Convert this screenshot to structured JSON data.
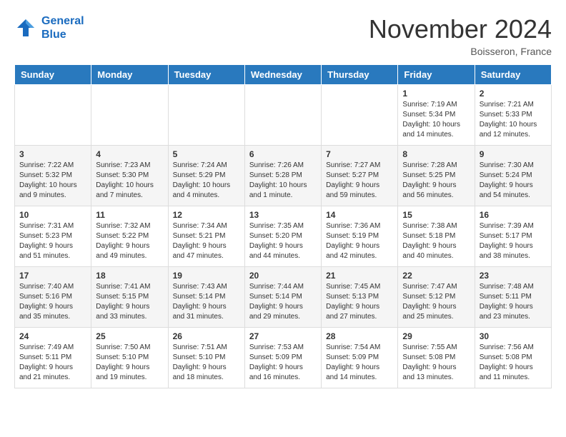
{
  "header": {
    "logo_line1": "General",
    "logo_line2": "Blue",
    "month_title": "November 2024",
    "location": "Boisseron, France"
  },
  "days_of_week": [
    "Sunday",
    "Monday",
    "Tuesday",
    "Wednesday",
    "Thursday",
    "Friday",
    "Saturday"
  ],
  "weeks": [
    {
      "cells": [
        {
          "empty": true
        },
        {
          "empty": true
        },
        {
          "empty": true
        },
        {
          "empty": true
        },
        {
          "empty": true
        },
        {
          "day": 1,
          "sunrise": "7:19 AM",
          "sunset": "5:34 PM",
          "daylight": "10 hours and 14 minutes."
        },
        {
          "day": 2,
          "sunrise": "7:21 AM",
          "sunset": "5:33 PM",
          "daylight": "10 hours and 12 minutes."
        }
      ]
    },
    {
      "cells": [
        {
          "day": 3,
          "sunrise": "7:22 AM",
          "sunset": "5:32 PM",
          "daylight": "10 hours and 9 minutes."
        },
        {
          "day": 4,
          "sunrise": "7:23 AM",
          "sunset": "5:30 PM",
          "daylight": "10 hours and 7 minutes."
        },
        {
          "day": 5,
          "sunrise": "7:24 AM",
          "sunset": "5:29 PM",
          "daylight": "10 hours and 4 minutes."
        },
        {
          "day": 6,
          "sunrise": "7:26 AM",
          "sunset": "5:28 PM",
          "daylight": "10 hours and 1 minute."
        },
        {
          "day": 7,
          "sunrise": "7:27 AM",
          "sunset": "5:27 PM",
          "daylight": "9 hours and 59 minutes."
        },
        {
          "day": 8,
          "sunrise": "7:28 AM",
          "sunset": "5:25 PM",
          "daylight": "9 hours and 56 minutes."
        },
        {
          "day": 9,
          "sunrise": "7:30 AM",
          "sunset": "5:24 PM",
          "daylight": "9 hours and 54 minutes."
        }
      ]
    },
    {
      "cells": [
        {
          "day": 10,
          "sunrise": "7:31 AM",
          "sunset": "5:23 PM",
          "daylight": "9 hours and 51 minutes."
        },
        {
          "day": 11,
          "sunrise": "7:32 AM",
          "sunset": "5:22 PM",
          "daylight": "9 hours and 49 minutes."
        },
        {
          "day": 12,
          "sunrise": "7:34 AM",
          "sunset": "5:21 PM",
          "daylight": "9 hours and 47 minutes."
        },
        {
          "day": 13,
          "sunrise": "7:35 AM",
          "sunset": "5:20 PM",
          "daylight": "9 hours and 44 minutes."
        },
        {
          "day": 14,
          "sunrise": "7:36 AM",
          "sunset": "5:19 PM",
          "daylight": "9 hours and 42 minutes."
        },
        {
          "day": 15,
          "sunrise": "7:38 AM",
          "sunset": "5:18 PM",
          "daylight": "9 hours and 40 minutes."
        },
        {
          "day": 16,
          "sunrise": "7:39 AM",
          "sunset": "5:17 PM",
          "daylight": "9 hours and 38 minutes."
        }
      ]
    },
    {
      "cells": [
        {
          "day": 17,
          "sunrise": "7:40 AM",
          "sunset": "5:16 PM",
          "daylight": "9 hours and 35 minutes."
        },
        {
          "day": 18,
          "sunrise": "7:41 AM",
          "sunset": "5:15 PM",
          "daylight": "9 hours and 33 minutes."
        },
        {
          "day": 19,
          "sunrise": "7:43 AM",
          "sunset": "5:14 PM",
          "daylight": "9 hours and 31 minutes."
        },
        {
          "day": 20,
          "sunrise": "7:44 AM",
          "sunset": "5:14 PM",
          "daylight": "9 hours and 29 minutes."
        },
        {
          "day": 21,
          "sunrise": "7:45 AM",
          "sunset": "5:13 PM",
          "daylight": "9 hours and 27 minutes."
        },
        {
          "day": 22,
          "sunrise": "7:47 AM",
          "sunset": "5:12 PM",
          "daylight": "9 hours and 25 minutes."
        },
        {
          "day": 23,
          "sunrise": "7:48 AM",
          "sunset": "5:11 PM",
          "daylight": "9 hours and 23 minutes."
        }
      ]
    },
    {
      "cells": [
        {
          "day": 24,
          "sunrise": "7:49 AM",
          "sunset": "5:11 PM",
          "daylight": "9 hours and 21 minutes."
        },
        {
          "day": 25,
          "sunrise": "7:50 AM",
          "sunset": "5:10 PM",
          "daylight": "9 hours and 19 minutes."
        },
        {
          "day": 26,
          "sunrise": "7:51 AM",
          "sunset": "5:10 PM",
          "daylight": "9 hours and 18 minutes."
        },
        {
          "day": 27,
          "sunrise": "7:53 AM",
          "sunset": "5:09 PM",
          "daylight": "9 hours and 16 minutes."
        },
        {
          "day": 28,
          "sunrise": "7:54 AM",
          "sunset": "5:09 PM",
          "daylight": "9 hours and 14 minutes."
        },
        {
          "day": 29,
          "sunrise": "7:55 AM",
          "sunset": "5:08 PM",
          "daylight": "9 hours and 13 minutes."
        },
        {
          "day": 30,
          "sunrise": "7:56 AM",
          "sunset": "5:08 PM",
          "daylight": "9 hours and 11 minutes."
        }
      ]
    }
  ],
  "labels": {
    "sunrise": "Sunrise:",
    "sunset": "Sunset:",
    "daylight": "Daylight:"
  }
}
